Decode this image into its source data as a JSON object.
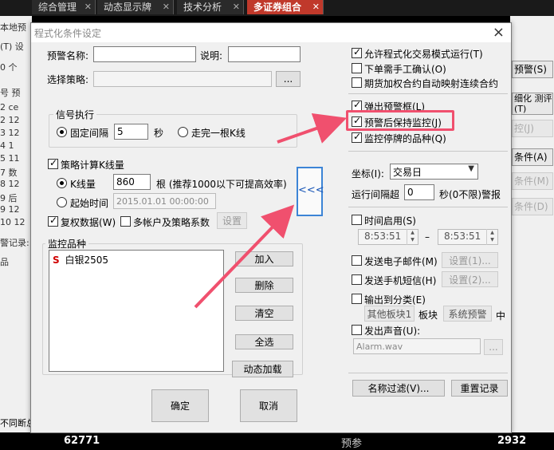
{
  "app_tabs": [
    {
      "label": "综合管理"
    },
    {
      "label": "动态显示牌"
    },
    {
      "label": "技术分析"
    },
    {
      "label": "多证券组合"
    }
  ],
  "bg_left": {
    "texts": [
      "本地预",
      "(T) 设",
      "0 个",
      "号 预",
      "2 ce",
      "2 12",
      "3 12",
      "4 1",
      "5 11",
      "7 数",
      "8 12",
      "9 后",
      "9 12",
      "10 12",
      "警记录:",
      "品",
      "不同断总"
    ]
  },
  "bg_right": {
    "buttons": [
      "预警(S)",
      "细化 测评(T)",
      "控(J)",
      "条件(A)",
      "条件(M)",
      "条件(D)"
    ]
  },
  "bg_bottom": {
    "left_number": "62771",
    "mid_text": "预参",
    "right_number": "2932"
  },
  "dialog": {
    "title": "程式化条件设定",
    "close_glyph": "×",
    "alert_name_label": "预警名称:",
    "alert_name_value": "",
    "desc_label": "说明:",
    "desc_value": "",
    "strategy_label": "选择策略:",
    "strategy_value": "",
    "browse_label": "...",
    "signal_group": {
      "title": "信号执行",
      "fixed_interval_label": "固定间隔",
      "interval_value": "5",
      "seconds_label": "秒",
      "kline_label": "走完一根K线"
    },
    "kline_calc": {
      "label": "策略计算K线量",
      "kline_count_label": "K线量",
      "kline_count_value": "860",
      "kline_hint": "根 (推荐1000以下可提高效率)",
      "start_time_label": "起始时间",
      "start_time_value": "2015.01.01 00:00:00"
    },
    "adjust_label": "复权数据(W)",
    "multi_account_label": "多帐户及策略系数",
    "settings_label": "设置",
    "monitor_group": {
      "title": "监控品种",
      "items": [
        {
          "tag": "S",
          "name": "白银2505"
        }
      ],
      "buttons": {
        "add": "加入",
        "delete": "删除",
        "clear": "清空",
        "select_all": "全选",
        "dynamic_load": "动态加载"
      }
    },
    "ok_label": "确定",
    "cancel_label": "取消",
    "collapse_glyph": "<<<",
    "right": {
      "allow_auto_trade": "允许程式化交易模式运行(T)",
      "order_confirm": "下单需手工确认(O)",
      "futures_map": "期货加权合约自动映射连续合约",
      "popup_alert": "弹出预警框(L)",
      "keep_monitor": "预警后保持监控(J)",
      "monitor_suspended": "监控停牌的品种(Q)",
      "axis_label": "坐标(I):",
      "axis_value": "交易日",
      "interval_label": "运行间隔超",
      "interval_value": "0",
      "interval_unit": "秒(0不限)警报",
      "time_enable": "时间启用(S)",
      "time_start": "8:53:51",
      "time_dash": "–",
      "time_end": "8:53:51",
      "send_email": "发送电子邮件(M)",
      "email_settings": "设置(1)...",
      "send_sms": "发送手机短信(H)",
      "sms_settings": "设置(2)...",
      "output_category": "输出到分类(E)",
      "other_block": "其他板块1",
      "block_label": "板块",
      "sys_alert": "系统预警",
      "middle_label": "中",
      "play_sound": "发出声音(U):",
      "sound_file": "Alarm.wav",
      "sound_browse": "...",
      "name_filter": "名称过滤(V)...",
      "reset_record": "重置记录"
    }
  },
  "colors": {
    "highlight": "#f0506e",
    "accent_blue": "#3c84d6",
    "tab_active": "#c0392b"
  },
  "checkbox_state": {
    "allow_auto_trade": true,
    "order_confirm": false,
    "futures_map": false,
    "popup_alert": true,
    "keep_monitor": true,
    "monitor_suspended": true,
    "time_enable": false,
    "send_email": false,
    "send_sms": false,
    "output_category": false,
    "play_sound": false,
    "kline_calc": true,
    "adjust": true,
    "multi_account": false
  }
}
